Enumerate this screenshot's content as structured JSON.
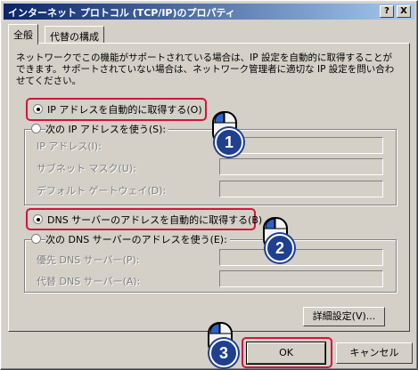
{
  "window": {
    "title": "インターネット プロトコル (TCP/IP)のプロパティ",
    "help_label": "?",
    "close_label": "X"
  },
  "tabs": [
    {
      "label": "全般",
      "active": true
    },
    {
      "label": "代替の構成",
      "active": false
    }
  ],
  "description": "ネットワークでこの機能がサポートされている場合は、IP 設定を自動的に取得することができます。サポートされていない場合は、ネットワーク管理者に適切な IP 設定を問い合わせてください。",
  "ip_auto_label": "IP アドレスを自動的に取得する(O)",
  "ip_manual_label": "次の IP アドレスを使う(S):",
  "ip_fields": [
    {
      "label": "IP アドレス(I):",
      "value": ""
    },
    {
      "label": "サブネット マスク(U):",
      "value": ""
    },
    {
      "label": "デフォルト ゲートウェイ(D):",
      "value": ""
    }
  ],
  "dns_auto_label": "DNS サーバーのアドレスを自動的に取得する(B)",
  "dns_manual_label": "次の DNS サーバーのアドレスを使う(E):",
  "dns_fields": [
    {
      "label": "優先 DNS サーバー(P):",
      "value": ""
    },
    {
      "label": "代替 DNS サーバー(A):",
      "value": ""
    }
  ],
  "advanced_label": "詳細設定(V)...",
  "ok_label": "OK",
  "cancel_label": "キャンセル",
  "steps": [
    "1",
    "2",
    "3"
  ],
  "colors": {
    "highlight": "#d4143a",
    "badge": "#1f3f8f",
    "title_start": "#0a246a",
    "title_end": "#a6caf0"
  }
}
